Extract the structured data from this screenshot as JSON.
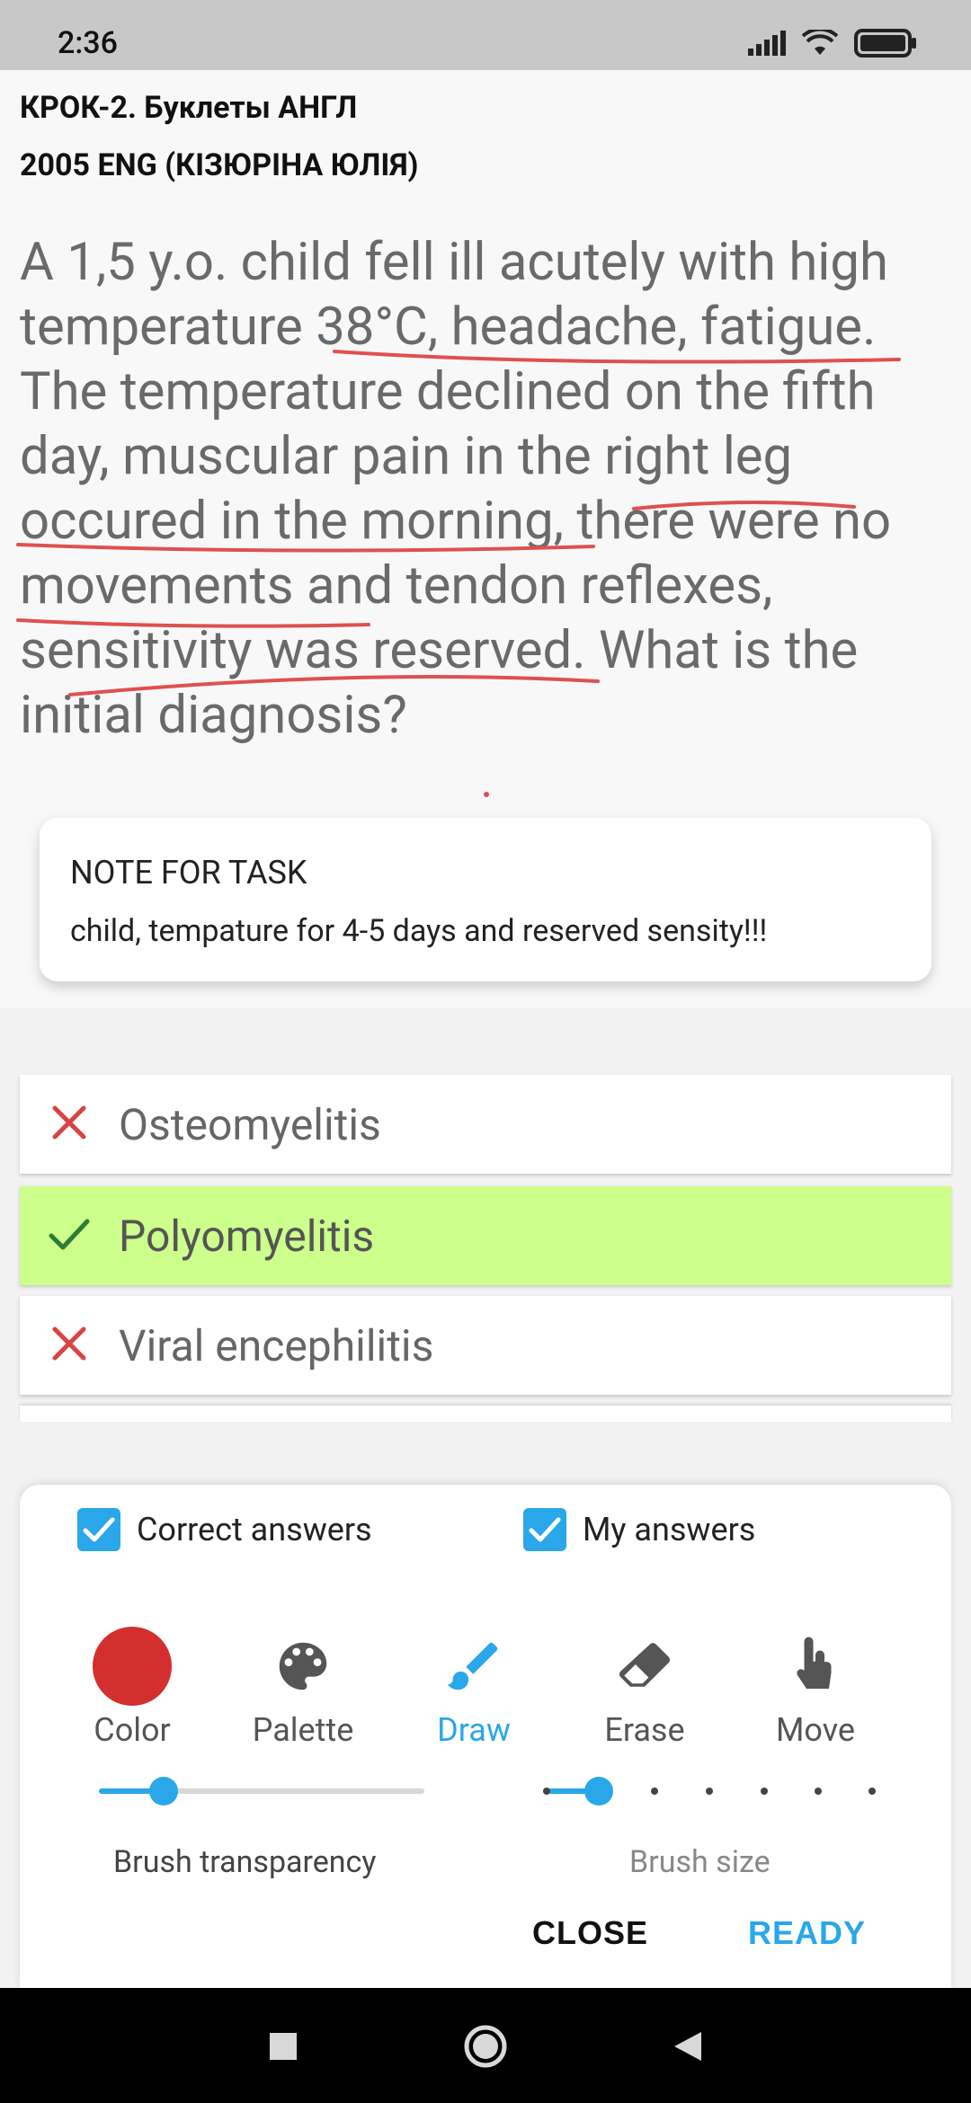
{
  "status_bar": {
    "time": "2:36",
    "signal_icon": "signal-icon",
    "wifi_icon": "wifi-icon",
    "battery_icon": "battery-icon"
  },
  "header": {
    "line1": "КРОК-2. Буклеты АНГЛ",
    "line2": "2005 ENG (КІЗЮРІНА ЮЛІЯ)"
  },
  "question": {
    "text": "A 1,5 y.o. child fell ill acutely with high temperature 38°C, headache, fatigue. The temperature declined on the fifth day, muscular pain in the right leg occured in the morning, there were no movements and tendon reflexes, sensitivity was reserved. What is the initial diagnosis?"
  },
  "note": {
    "title": "NOTE FOR TASK",
    "body": "child, tempature for 4-5 days and reserved sensity!!!"
  },
  "answers": [
    {
      "label": "Osteomyelitis",
      "status": "wrong",
      "icon": "cross-icon"
    },
    {
      "label": "Polyomyelitis",
      "status": "correct",
      "icon": "check-icon"
    },
    {
      "label": "Viral encephilitis",
      "status": "wrong",
      "icon": "cross-icon"
    }
  ],
  "drawing_panel": {
    "correct_answers_label": "Correct answers",
    "correct_answers_checked": true,
    "my_answers_label": "My answers",
    "my_answers_checked": true,
    "tools": [
      {
        "label": "Color",
        "icon": "color-swatch-icon",
        "active": false
      },
      {
        "label": "Palette",
        "icon": "palette-icon",
        "active": false
      },
      {
        "label": "Draw",
        "icon": "brush-icon",
        "active": true
      },
      {
        "label": "Erase",
        "icon": "eraser-icon",
        "active": false
      },
      {
        "label": "Move",
        "icon": "hand-pointer-icon",
        "active": false
      }
    ],
    "brush_color": "#d32f2f",
    "accent_color": "#2aa7e8",
    "brush_transparency_label": "Brush transparency",
    "brush_transparency_value": 0.2,
    "brush_size_label": "Brush size",
    "brush_size_step": 2,
    "brush_size_steps": 7,
    "close_label": "CLOSE",
    "ready_label": "READY"
  },
  "nav": {
    "recents_icon": "square-icon",
    "home_icon": "circle-icon",
    "back_icon": "triangle-back-icon"
  }
}
